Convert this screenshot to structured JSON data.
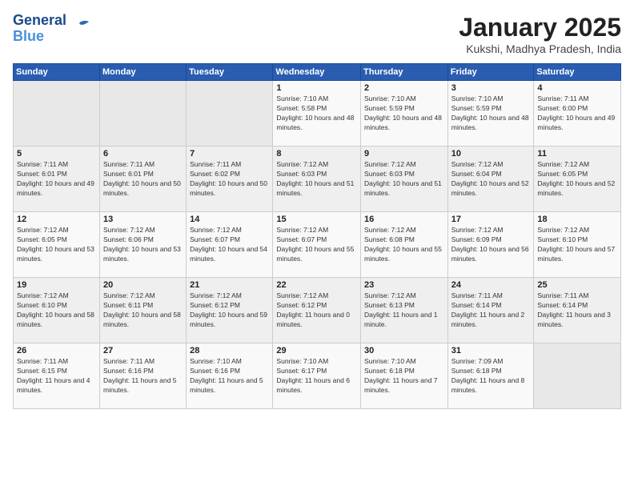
{
  "header": {
    "logo_line1": "General",
    "logo_line2": "Blue",
    "month": "January 2025",
    "location": "Kukshi, Madhya Pradesh, India"
  },
  "weekdays": [
    "Sunday",
    "Monday",
    "Tuesday",
    "Wednesday",
    "Thursday",
    "Friday",
    "Saturday"
  ],
  "weeks": [
    [
      {
        "day": "",
        "sunrise": "",
        "sunset": "",
        "daylight": ""
      },
      {
        "day": "",
        "sunrise": "",
        "sunset": "",
        "daylight": ""
      },
      {
        "day": "",
        "sunrise": "",
        "sunset": "",
        "daylight": ""
      },
      {
        "day": "1",
        "sunrise": "Sunrise: 7:10 AM",
        "sunset": "Sunset: 5:58 PM",
        "daylight": "Daylight: 10 hours and 48 minutes."
      },
      {
        "day": "2",
        "sunrise": "Sunrise: 7:10 AM",
        "sunset": "Sunset: 5:59 PM",
        "daylight": "Daylight: 10 hours and 48 minutes."
      },
      {
        "day": "3",
        "sunrise": "Sunrise: 7:10 AM",
        "sunset": "Sunset: 5:59 PM",
        "daylight": "Daylight: 10 hours and 48 minutes."
      },
      {
        "day": "4",
        "sunrise": "Sunrise: 7:11 AM",
        "sunset": "Sunset: 6:00 PM",
        "daylight": "Daylight: 10 hours and 49 minutes."
      }
    ],
    [
      {
        "day": "5",
        "sunrise": "Sunrise: 7:11 AM",
        "sunset": "Sunset: 6:01 PM",
        "daylight": "Daylight: 10 hours and 49 minutes."
      },
      {
        "day": "6",
        "sunrise": "Sunrise: 7:11 AM",
        "sunset": "Sunset: 6:01 PM",
        "daylight": "Daylight: 10 hours and 50 minutes."
      },
      {
        "day": "7",
        "sunrise": "Sunrise: 7:11 AM",
        "sunset": "Sunset: 6:02 PM",
        "daylight": "Daylight: 10 hours and 50 minutes."
      },
      {
        "day": "8",
        "sunrise": "Sunrise: 7:12 AM",
        "sunset": "Sunset: 6:03 PM",
        "daylight": "Daylight: 10 hours and 51 minutes."
      },
      {
        "day": "9",
        "sunrise": "Sunrise: 7:12 AM",
        "sunset": "Sunset: 6:03 PM",
        "daylight": "Daylight: 10 hours and 51 minutes."
      },
      {
        "day": "10",
        "sunrise": "Sunrise: 7:12 AM",
        "sunset": "Sunset: 6:04 PM",
        "daylight": "Daylight: 10 hours and 52 minutes."
      },
      {
        "day": "11",
        "sunrise": "Sunrise: 7:12 AM",
        "sunset": "Sunset: 6:05 PM",
        "daylight": "Daylight: 10 hours and 52 minutes."
      }
    ],
    [
      {
        "day": "12",
        "sunrise": "Sunrise: 7:12 AM",
        "sunset": "Sunset: 6:05 PM",
        "daylight": "Daylight: 10 hours and 53 minutes."
      },
      {
        "day": "13",
        "sunrise": "Sunrise: 7:12 AM",
        "sunset": "Sunset: 6:06 PM",
        "daylight": "Daylight: 10 hours and 53 minutes."
      },
      {
        "day": "14",
        "sunrise": "Sunrise: 7:12 AM",
        "sunset": "Sunset: 6:07 PM",
        "daylight": "Daylight: 10 hours and 54 minutes."
      },
      {
        "day": "15",
        "sunrise": "Sunrise: 7:12 AM",
        "sunset": "Sunset: 6:07 PM",
        "daylight": "Daylight: 10 hours and 55 minutes."
      },
      {
        "day": "16",
        "sunrise": "Sunrise: 7:12 AM",
        "sunset": "Sunset: 6:08 PM",
        "daylight": "Daylight: 10 hours and 55 minutes."
      },
      {
        "day": "17",
        "sunrise": "Sunrise: 7:12 AM",
        "sunset": "Sunset: 6:09 PM",
        "daylight": "Daylight: 10 hours and 56 minutes."
      },
      {
        "day": "18",
        "sunrise": "Sunrise: 7:12 AM",
        "sunset": "Sunset: 6:10 PM",
        "daylight": "Daylight: 10 hours and 57 minutes."
      }
    ],
    [
      {
        "day": "19",
        "sunrise": "Sunrise: 7:12 AM",
        "sunset": "Sunset: 6:10 PM",
        "daylight": "Daylight: 10 hours and 58 minutes."
      },
      {
        "day": "20",
        "sunrise": "Sunrise: 7:12 AM",
        "sunset": "Sunset: 6:11 PM",
        "daylight": "Daylight: 10 hours and 58 minutes."
      },
      {
        "day": "21",
        "sunrise": "Sunrise: 7:12 AM",
        "sunset": "Sunset: 6:12 PM",
        "daylight": "Daylight: 10 hours and 59 minutes."
      },
      {
        "day": "22",
        "sunrise": "Sunrise: 7:12 AM",
        "sunset": "Sunset: 6:12 PM",
        "daylight": "Daylight: 11 hours and 0 minutes."
      },
      {
        "day": "23",
        "sunrise": "Sunrise: 7:12 AM",
        "sunset": "Sunset: 6:13 PM",
        "daylight": "Daylight: 11 hours and 1 minute."
      },
      {
        "day": "24",
        "sunrise": "Sunrise: 7:11 AM",
        "sunset": "Sunset: 6:14 PM",
        "daylight": "Daylight: 11 hours and 2 minutes."
      },
      {
        "day": "25",
        "sunrise": "Sunrise: 7:11 AM",
        "sunset": "Sunset: 6:14 PM",
        "daylight": "Daylight: 11 hours and 3 minutes."
      }
    ],
    [
      {
        "day": "26",
        "sunrise": "Sunrise: 7:11 AM",
        "sunset": "Sunset: 6:15 PM",
        "daylight": "Daylight: 11 hours and 4 minutes."
      },
      {
        "day": "27",
        "sunrise": "Sunrise: 7:11 AM",
        "sunset": "Sunset: 6:16 PM",
        "daylight": "Daylight: 11 hours and 5 minutes."
      },
      {
        "day": "28",
        "sunrise": "Sunrise: 7:10 AM",
        "sunset": "Sunset: 6:16 PM",
        "daylight": "Daylight: 11 hours and 5 minutes."
      },
      {
        "day": "29",
        "sunrise": "Sunrise: 7:10 AM",
        "sunset": "Sunset: 6:17 PM",
        "daylight": "Daylight: 11 hours and 6 minutes."
      },
      {
        "day": "30",
        "sunrise": "Sunrise: 7:10 AM",
        "sunset": "Sunset: 6:18 PM",
        "daylight": "Daylight: 11 hours and 7 minutes."
      },
      {
        "day": "31",
        "sunrise": "Sunrise: 7:09 AM",
        "sunset": "Sunset: 6:18 PM",
        "daylight": "Daylight: 11 hours and 8 minutes."
      },
      {
        "day": "",
        "sunrise": "",
        "sunset": "",
        "daylight": ""
      }
    ]
  ]
}
